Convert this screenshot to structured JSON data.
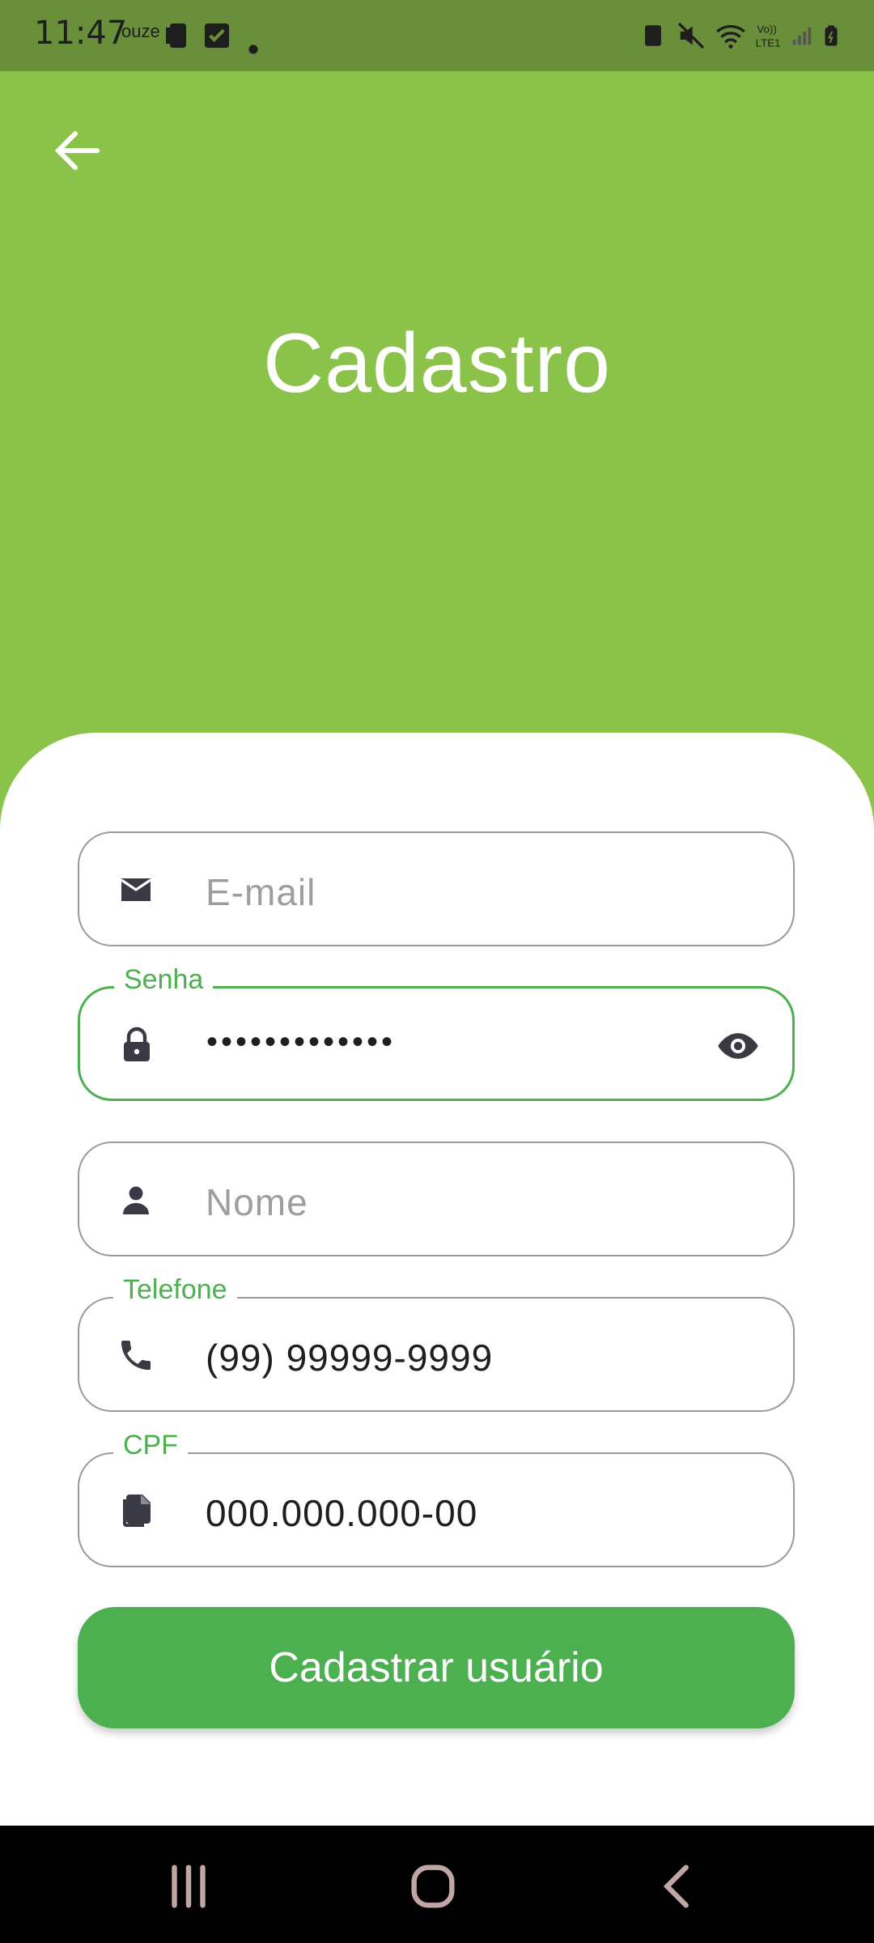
{
  "status_bar": {
    "time": "11:47",
    "carrier": "ouze"
  },
  "header": {
    "title": "Cadastro",
    "color": "#8bc34a"
  },
  "form": {
    "email": {
      "placeholder": "E-mail",
      "icon": "mail-icon"
    },
    "senha": {
      "label": "Senha",
      "value": "•••••••••••••",
      "icon": "lock-icon",
      "toggle_icon": "eye-icon"
    },
    "nome": {
      "placeholder": "Nome",
      "icon": "person-icon"
    },
    "telefone": {
      "label": "Telefone",
      "value": "(99) 99999-9999",
      "icon": "phone-icon"
    },
    "cpf": {
      "label": "CPF",
      "value": "000.000.000-00",
      "icon": "document-icon"
    },
    "submit_label": "Cadastrar usuário",
    "accent_color": "#4caf50"
  },
  "nav": {
    "recents_icon": "recents-icon",
    "home_icon": "home-icon",
    "back_icon": "back-icon"
  }
}
